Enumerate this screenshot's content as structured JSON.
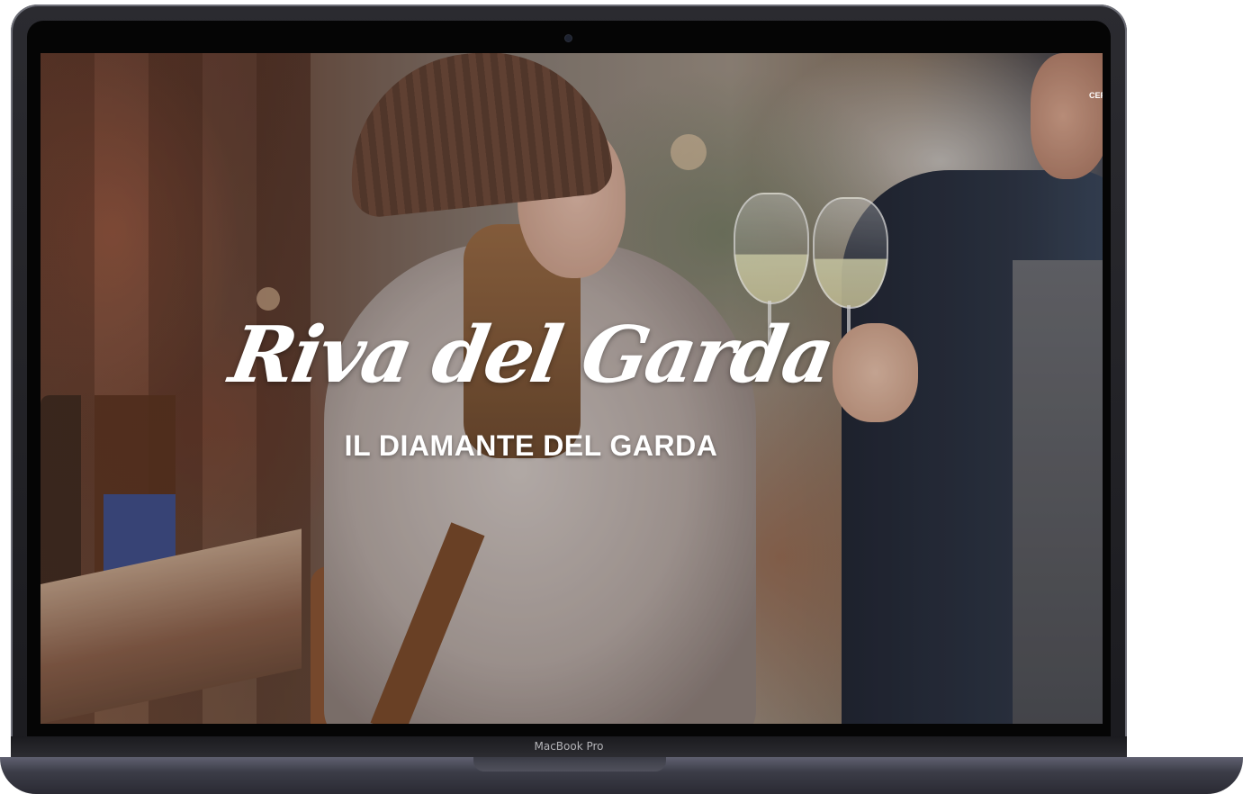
{
  "device": {
    "brand_label": "MacBook Pro"
  },
  "hero": {
    "title": "Riva del Garda",
    "subtitle": "IL DIAMANTE DEL GARDA"
  },
  "nav": {
    "partial_item": "CER"
  },
  "colors": {
    "hero_text": "#ffffff",
    "bezel": "#050505",
    "device_body": "#2b2b30"
  }
}
